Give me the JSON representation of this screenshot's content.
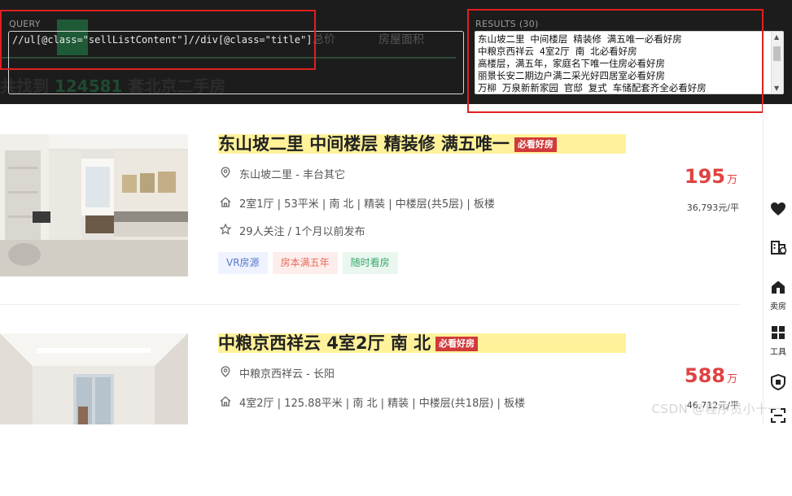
{
  "helper": {
    "query_label": "QUERY",
    "results_label": "RESULTS (30)",
    "query_text": "//ul[@class=\"sellListContent\"]//div[@class=\"title\"]",
    "results": [
      "东山坡二里 中间楼层 精装修 满五唯一必看好房",
      "中粮京西祥云 4室2厅 南 北必看好房",
      "高楼层，满五年，家庭名下唯一住房必看好房",
      "丽景长安二期边户满二采光好四居室必看好房",
      "万柳 万泉新新家园 官邸 复式 车储配套齐全必看好房"
    ]
  },
  "underlay": {
    "sort_tabs": [
      "总价",
      "房屋面积"
    ],
    "count_prefix": "共找到 ",
    "count_value": "124581",
    "count_suffix": " 套北京二手房"
  },
  "listings": [
    {
      "title": "东山坡二里 中间楼层 精装修 满五唯一",
      "badge": "必看好房",
      "location": "东山坡二里 - 丰台其它",
      "house_info": "2室1厅 | 53平米 | 南 北 | 精装 | 中楼层(共5层) | 板楼",
      "follow_info": "29人关注 / 1个月以前发布",
      "price": "195",
      "price_unit": "万",
      "unit_price": "36,793元/平",
      "tags": [
        "VR房源",
        "房本满五年",
        "随时看房"
      ]
    },
    {
      "title": "中粮京西祥云 4室2厅 南 北",
      "badge": "必看好房",
      "location": "中粮京西祥云 - 长阳",
      "house_info": "4室2厅 | 125.88平米 | 南 北 | 精装 | 中楼层(共18层) | 板楼",
      "price": "588",
      "price_unit": "万",
      "unit_price": "46,712元/平"
    }
  ],
  "rail": {
    "sell_label": "卖房",
    "tools_label": "工具"
  },
  "watermark": "CSDN @程序员小十一",
  "colors": {
    "price_red": "#e04242",
    "badge_red": "#d13a3a",
    "title_highlight": "#fff29a",
    "frame_red": "#e02020"
  }
}
